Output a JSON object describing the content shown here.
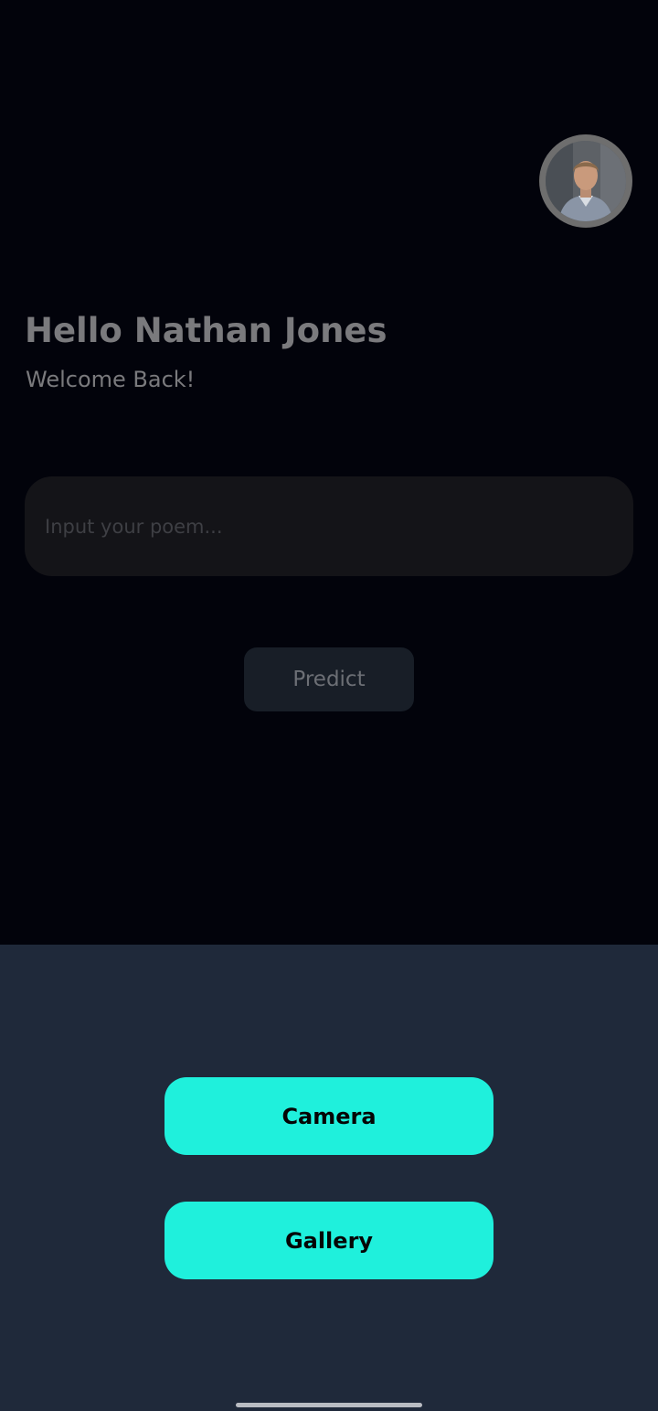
{
  "header": {
    "avatar_icon": "user-avatar-photo"
  },
  "greeting": {
    "title": "Hello Nathan Jones",
    "subtitle": "Welcome Back!"
  },
  "poem": {
    "placeholder": "Input your poem...",
    "value": ""
  },
  "actions": {
    "predict_label": "Predict"
  },
  "bottom_sheet": {
    "camera_label": "Camera",
    "gallery_label": "Gallery"
  },
  "colors": {
    "background": "#02030b",
    "sheet": "#1f293a",
    "accent": "#1ff0dc",
    "input_bg": "#141418",
    "predict_bg": "#181e27"
  }
}
